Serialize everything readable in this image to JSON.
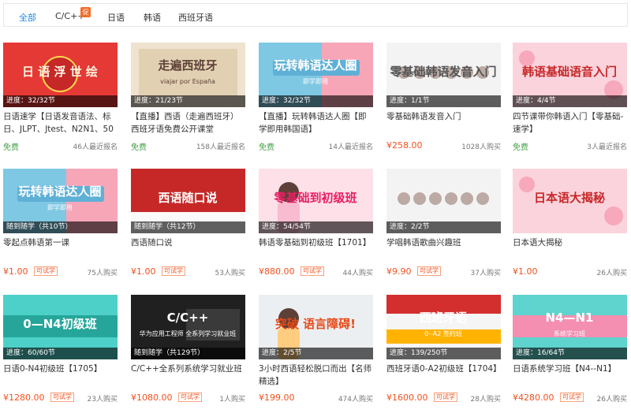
{
  "tabs": [
    {
      "label": "全部",
      "active": true
    },
    {
      "label": "C/C++",
      "badge": "促"
    },
    {
      "label": "日语"
    },
    {
      "label": "韩语"
    },
    {
      "label": "西班牙语"
    }
  ],
  "courses": [
    {
      "thumb_title": "日 语 浮 世 绘",
      "thumb_theme": "red",
      "progress": "进度：32/32节",
      "title": "日语速学【日语发音语法、标日、JLPT、Jtest、N2N1、50音】",
      "price": "免费",
      "free": true,
      "count": "46人最近报名"
    },
    {
      "thumb_title": "走遍西班牙",
      "thumb_sub": "viajar por España",
      "thumb_theme": "beige",
      "progress": "进度：21/23节",
      "title": "【直播】西语（走遍西班牙）西班牙语免费公开课堂",
      "price": "免费",
      "free": true,
      "count": "158人最近报名"
    },
    {
      "thumb_title": "玩转韩语达人圈",
      "thumb_sub": "即学即用",
      "thumb_theme": "blue",
      "progress": "进度：32/32节",
      "title": "【直播】玩转韩语达人圈【即学即用韩国语】",
      "price": "免费",
      "free": true,
      "count": "14人最近报名"
    },
    {
      "thumb_title": "零基础韩语发音入门",
      "thumb_theme": "people",
      "progress": "进度：1/1节",
      "title": "零基础韩语发音入门",
      "price": "¥258.00",
      "free": false,
      "count": "1028人购买"
    },
    {
      "thumb_title": "韩语基础语音入门",
      "thumb_theme": "pink",
      "progress": "进度：4/4节",
      "title": "四节课带你韩语入门【零基础-速学】",
      "price": "免费",
      "free": true,
      "count": "3人最近报名"
    },
    {
      "thumb_title": "玩转韩语达人圈",
      "thumb_sub": "即学即用",
      "thumb_theme": "blue",
      "progress": "随到随学（共10节）",
      "title": "零起点韩语第一课",
      "price": "¥1.00",
      "free": false,
      "trial": "可试学",
      "count": "75人购买"
    },
    {
      "thumb_title": "西语随口说",
      "thumb_theme": "redwhite",
      "progress": "随到随学（共12节）",
      "title": "西语随口说",
      "price": "¥1.00",
      "free": false,
      "trial": "可试学",
      "count": "53人购买"
    },
    {
      "thumb_title": "零基础到初级班",
      "thumb_theme": "girl",
      "progress": "进度：54/54节",
      "title": "韩语零基础到初级班【1701】",
      "price": "¥880.00",
      "free": false,
      "trial": "可试学",
      "count": "44人购买"
    },
    {
      "thumb_title": "",
      "thumb_theme": "people",
      "progress": "进度：2/2节",
      "title": "学唱韩语歌曲兴趣班",
      "price": "¥9.90",
      "free": false,
      "trial": "可试学",
      "count": "37人购买"
    },
    {
      "thumb_title": "日本语大揭秘",
      "thumb_theme": "pink",
      "progress": "",
      "title": "日本语大揭秘",
      "price": "¥1.00",
      "free": false,
      "count": "26人购买"
    },
    {
      "thumb_title": "0—N4初级班",
      "thumb_theme": "teal",
      "progress": "进度：60/60节",
      "title": "日语0-N4初级班【1705】",
      "price": "¥1280.00",
      "free": false,
      "trial": "可试学",
      "count": "23人购买"
    },
    {
      "thumb_title": "C/C++",
      "thumb_sub": "华为应用工程师 全系列学习就业班",
      "thumb_theme": "dark",
      "progress": "随到随学（共129节）",
      "title": "C/C++全系列系统学习就业班",
      "price": "¥1080.00",
      "free": false,
      "trial": "可试学",
      "count": "1人购买"
    },
    {
      "thumb_title": "突破 语言障碍!",
      "thumb_theme": "blonde",
      "progress": "进度：2/5节",
      "title": "3小时西语轻松脱口而出【名师精选】",
      "price": "¥199.00",
      "free": false,
      "count": "474人购买"
    },
    {
      "thumb_title": "西班牙语",
      "thumb_sub": "0--A2 签约班",
      "thumb_theme": "spain",
      "progress": "进度：139/250节",
      "title": "西班牙语0-A2初级班【1704】",
      "price": "¥1600.00",
      "free": false,
      "trial": "可试学",
      "count": "28人购买"
    },
    {
      "thumb_title": "N4—N1",
      "thumb_sub": "系统学习班",
      "thumb_theme": "teal2",
      "progress": "进度：16/64节",
      "title": "日语系统学习班【N4--N1】",
      "price": "¥4280.00",
      "free": false,
      "trial": "可试学",
      "count": "26人购买"
    }
  ]
}
